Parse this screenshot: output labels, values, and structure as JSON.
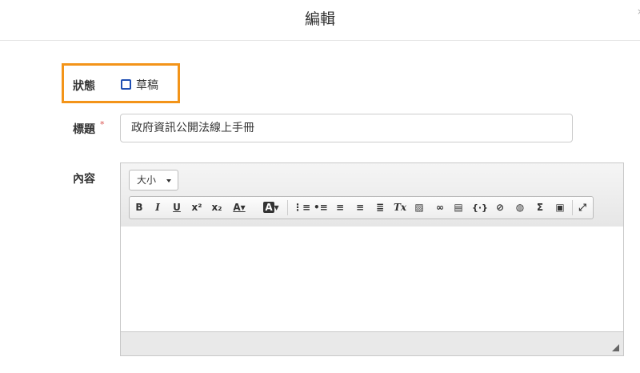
{
  "header": {
    "title": "編輯",
    "close_icon": "close-icon"
  },
  "form": {
    "status": {
      "label": "狀態",
      "checkbox_label": "草稿",
      "checked": false
    },
    "title_field": {
      "label": "標題",
      "required_mark": "*",
      "value": "政府資訊公開法線上手冊"
    },
    "content": {
      "label": "內容"
    }
  },
  "editor": {
    "size_select_value": "大小",
    "toolbar": [
      {
        "name": "bold-button",
        "glyph": "B"
      },
      {
        "name": "italic-button",
        "glyph": "I"
      },
      {
        "name": "underline-button",
        "glyph": "U"
      },
      {
        "name": "superscript-button",
        "glyph": "x²"
      },
      {
        "name": "subscript-button",
        "glyph": "x₂"
      },
      {
        "name": "text-color-button",
        "glyph": "A▾"
      },
      {
        "name": "bg-color-button",
        "glyph": "A▾"
      },
      {
        "name": "numbered-list-button",
        "glyph": "≔"
      },
      {
        "name": "bulleted-list-button",
        "glyph": "☰"
      },
      {
        "name": "align-left-button",
        "glyph": "≡"
      },
      {
        "name": "align-center-button",
        "glyph": "≡"
      },
      {
        "name": "justify-button",
        "glyph": "≣"
      },
      {
        "name": "remove-format-button",
        "glyph": "Tx"
      },
      {
        "name": "image-button",
        "glyph": "▨"
      },
      {
        "name": "link-button",
        "glyph": "∞"
      },
      {
        "name": "save-button",
        "glyph": "▤"
      },
      {
        "name": "code-block-button",
        "glyph": "{}"
      },
      {
        "name": "attachment-button",
        "glyph": "⊘"
      },
      {
        "name": "globe-button",
        "glyph": "◍"
      },
      {
        "name": "formula-button",
        "glyph": "Σ"
      },
      {
        "name": "source-button",
        "glyph": "▣"
      },
      {
        "name": "fullscreen-button",
        "glyph": "⤢"
      }
    ],
    "colors": {
      "accent_border": "#f39419",
      "checkbox": "#1f4fb3",
      "required": "#d9534f"
    }
  }
}
